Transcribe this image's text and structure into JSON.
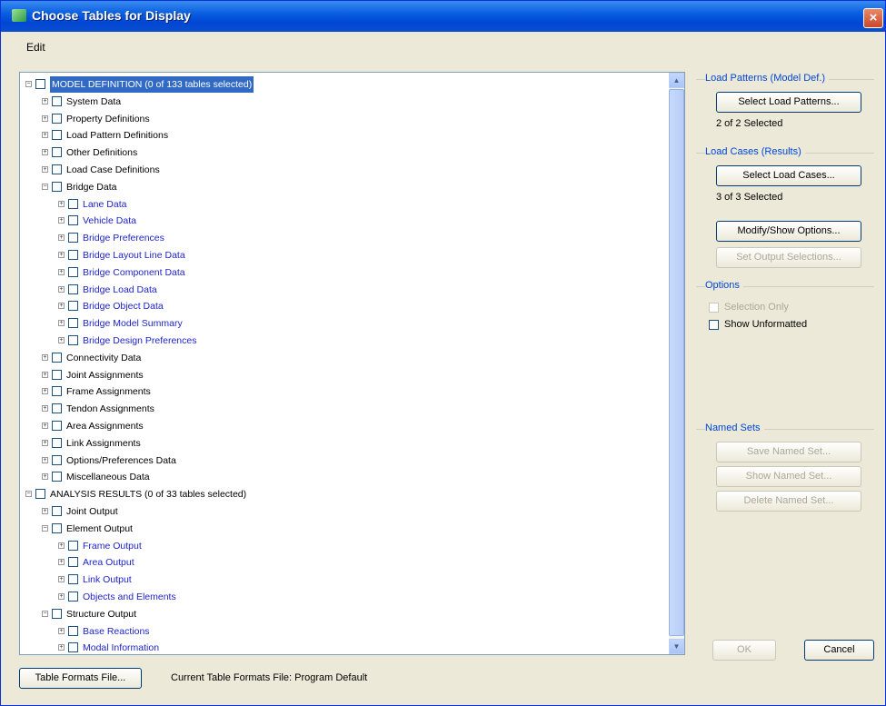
{
  "window": {
    "title": "Choose Tables for Display",
    "close_glyph": "×"
  },
  "menu": {
    "edit": "Edit"
  },
  "tree": [
    {
      "label": "MODEL DEFINITION (0 of 133 tables selected)",
      "level": 0,
      "expanded": true,
      "selected": true
    },
    {
      "label": "System Data",
      "level": 1,
      "expanded": false
    },
    {
      "label": "Property Definitions",
      "level": 1,
      "expanded": false
    },
    {
      "label": "Load Pattern Definitions",
      "level": 1,
      "expanded": false
    },
    {
      "label": "Other Definitions",
      "level": 1,
      "expanded": false
    },
    {
      "label": "Load Case Definitions",
      "level": 1,
      "expanded": false
    },
    {
      "label": "Bridge Data",
      "level": 1,
      "expanded": true
    },
    {
      "label": "Lane Data",
      "level": 2,
      "expanded": false,
      "blue": true
    },
    {
      "label": "Vehicle Data",
      "level": 2,
      "expanded": false,
      "blue": true
    },
    {
      "label": "Bridge Preferences",
      "level": 2,
      "expanded": false,
      "blue": true
    },
    {
      "label": "Bridge Layout Line Data",
      "level": 2,
      "expanded": false,
      "blue": true
    },
    {
      "label": "Bridge Component Data",
      "level": 2,
      "expanded": false,
      "blue": true
    },
    {
      "label": "Bridge Load Data",
      "level": 2,
      "expanded": false,
      "blue": true
    },
    {
      "label": "Bridge Object Data",
      "level": 2,
      "expanded": false,
      "blue": true
    },
    {
      "label": "Bridge Model Summary",
      "level": 2,
      "expanded": false,
      "blue": true
    },
    {
      "label": "Bridge Design Preferences",
      "level": 2,
      "expanded": false,
      "blue": true
    },
    {
      "label": "Connectivity Data",
      "level": 1,
      "expanded": false
    },
    {
      "label": "Joint Assignments",
      "level": 1,
      "expanded": false
    },
    {
      "label": "Frame Assignments",
      "level": 1,
      "expanded": false
    },
    {
      "label": "Tendon Assignments",
      "level": 1,
      "expanded": false
    },
    {
      "label": "Area Assignments",
      "level": 1,
      "expanded": false
    },
    {
      "label": "Link Assignments",
      "level": 1,
      "expanded": false
    },
    {
      "label": "Options/Preferences Data",
      "level": 1,
      "expanded": false
    },
    {
      "label": "Miscellaneous Data",
      "level": 1,
      "expanded": false
    },
    {
      "label": "ANALYSIS RESULTS (0 of 33 tables selected)",
      "level": 0,
      "expanded": true
    },
    {
      "label": "Joint Output",
      "level": 1,
      "expanded": false
    },
    {
      "label": "Element Output",
      "level": 1,
      "expanded": true
    },
    {
      "label": "Frame Output",
      "level": 2,
      "expanded": false,
      "blue": true
    },
    {
      "label": "Area Output",
      "level": 2,
      "expanded": false,
      "blue": true
    },
    {
      "label": "Link Output",
      "level": 2,
      "expanded": false,
      "blue": true
    },
    {
      "label": "Objects and Elements",
      "level": 2,
      "expanded": false,
      "blue": true
    },
    {
      "label": "Structure Output",
      "level": 1,
      "expanded": true
    },
    {
      "label": "Base Reactions",
      "level": 2,
      "expanded": false,
      "blue": true
    },
    {
      "label": "Modal Information",
      "level": 2,
      "expanded": false,
      "blue": true
    }
  ],
  "glyphs": {
    "expanded": "−",
    "collapsed": "+",
    "scroll_up": "▲",
    "scroll_down": "▼"
  },
  "right": {
    "load_patterns_title": "Load Patterns (Model Def.)",
    "select_load_patterns": "Select Load Patterns...",
    "load_patterns_status": "2 of 2 Selected",
    "load_cases_title": "Load Cases (Results)",
    "select_load_cases": "Select Load Cases...",
    "load_cases_status": "3 of 3 Selected",
    "modify_show_options": "Modify/Show Options...",
    "set_output_selections": "Set Output Selections...",
    "options_title": "Options",
    "selection_only": "Selection Only",
    "show_unformatted": "Show Unformatted",
    "named_sets_title": "Named Sets",
    "save_named_set": "Save Named Set...",
    "show_named_set": "Show Named Set...",
    "delete_named_set": "Delete Named Set..."
  },
  "bottom": {
    "table_formats_file": "Table Formats File...",
    "current_format_label": "Current Table Formats File:  Program Default",
    "ok": "OK",
    "cancel": "Cancel"
  }
}
